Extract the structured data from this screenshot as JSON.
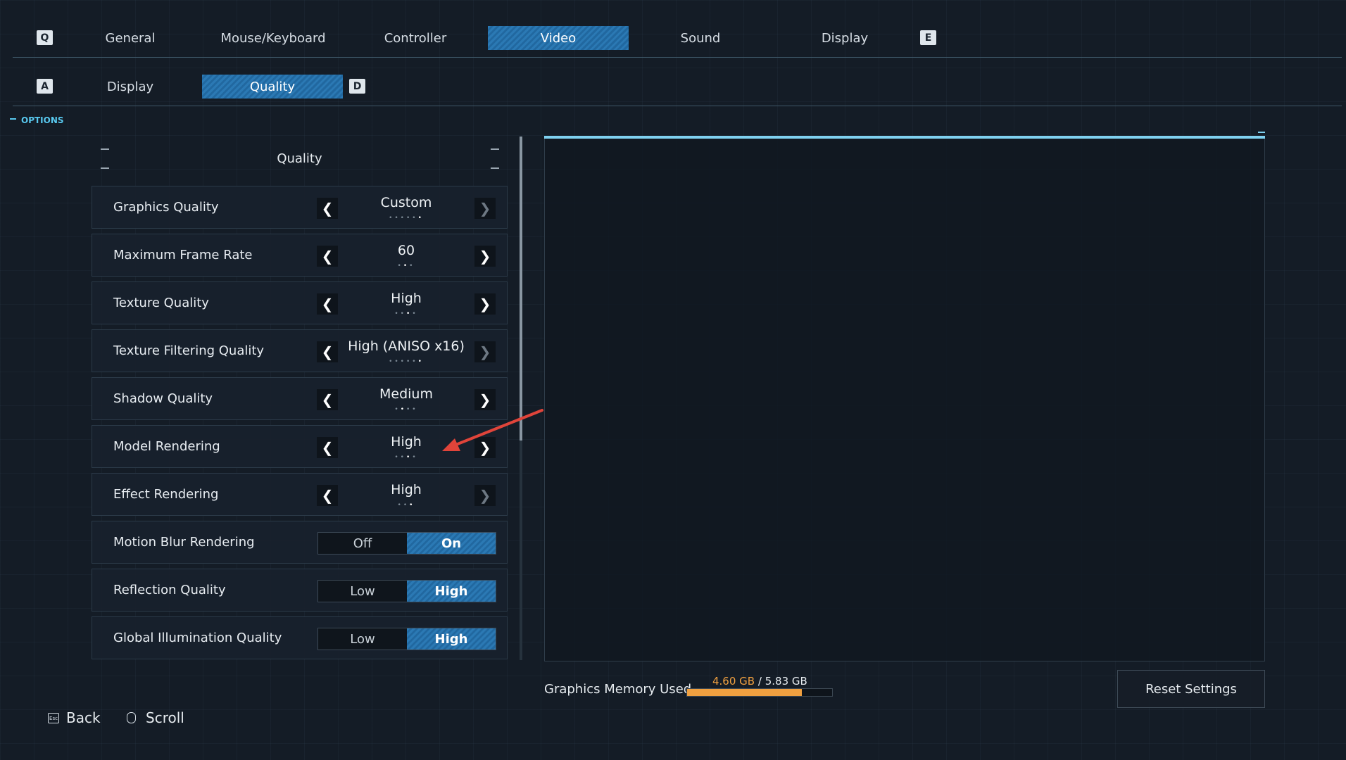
{
  "top_tabs": {
    "left_key": "Q",
    "right_key": "E",
    "items": [
      "General",
      "Mouse/Keyboard",
      "Controller",
      "Video",
      "Sound",
      "Display"
    ],
    "active": "Video"
  },
  "sub_tabs": {
    "left_key": "A",
    "right_key": "D",
    "items": [
      "Display",
      "Quality"
    ],
    "active": "Quality"
  },
  "options_label": "OPTIONS",
  "panel_title": "Quality",
  "settings": [
    {
      "label": "Graphics Quality",
      "type": "selector",
      "value": "Custom",
      "dots": 6,
      "selected_dot": 6,
      "right_arrow_dim": true
    },
    {
      "label": "Maximum Frame Rate",
      "type": "selector",
      "value": "60",
      "dots": 3,
      "selected_dot": 2,
      "right_arrow_dim": false
    },
    {
      "label": "Texture Quality",
      "type": "selector",
      "value": "High",
      "dots": 4,
      "selected_dot": 3,
      "right_arrow_dim": false
    },
    {
      "label": "Texture Filtering Quality",
      "type": "selector",
      "value": "High (ANISO x16)",
      "dots": 6,
      "selected_dot": 6,
      "right_arrow_dim": true
    },
    {
      "label": "Shadow Quality",
      "type": "selector",
      "value": "Medium",
      "dots": 4,
      "selected_dot": 2,
      "right_arrow_dim": false
    },
    {
      "label": "Model Rendering",
      "type": "selector",
      "value": "High",
      "dots": 4,
      "selected_dot": 3,
      "right_arrow_dim": false
    },
    {
      "label": "Effect Rendering",
      "type": "selector",
      "value": "High",
      "dots": 3,
      "selected_dot": 3,
      "right_arrow_dim": true
    },
    {
      "label": "Motion Blur Rendering",
      "type": "toggle",
      "options": [
        "Off",
        "On"
      ],
      "active": "On"
    },
    {
      "label": "Reflection Quality",
      "type": "toggle",
      "options": [
        "Low",
        "High"
      ],
      "active": "High"
    },
    {
      "label": "Global Illumination Quality",
      "type": "toggle",
      "options": [
        "Low",
        "High"
      ],
      "active": "High"
    }
  ],
  "memory": {
    "label": "Graphics Memory Used",
    "used": "4.60 GB",
    "separator": "/",
    "total": "5.83 GB",
    "fraction": 0.789
  },
  "reset_button": "Reset Settings",
  "footer": {
    "back_label": "Back",
    "scroll_label": "Scroll"
  },
  "colors": {
    "accent_blue": "#2b79b4",
    "memory_bar": "#f0a040",
    "annotation_arrow": "#e0443a"
  }
}
